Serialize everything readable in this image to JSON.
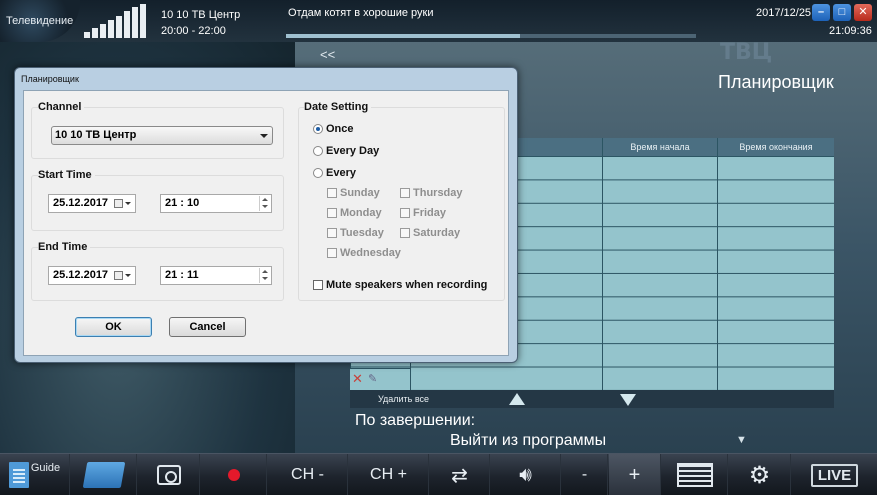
{
  "topbar": {
    "app_name": "Телевидение",
    "channel": "10 10 ТВ Центр",
    "time_range": "20:00 - 22:00",
    "program": "Отдам котят в хорошие руки",
    "progress_fraction": 0.57,
    "date": "2017/12/25",
    "clock": "21:09:36",
    "signal_bars": [
      0.18,
      0.3,
      0.42,
      0.54,
      0.66,
      0.78,
      0.9,
      1.0
    ],
    "window_buttons": [
      "minimize-icon",
      "maximize-icon",
      "close-icon"
    ]
  },
  "scheduler": {
    "back_label": "<<",
    "title": "Планировщик",
    "columns": [
      "Время начала",
      "Время окончания"
    ],
    "delete_all": "Удалить все",
    "on_finish_label": "По завершении:",
    "on_finish_value": "Выйти из программы"
  },
  "dialog": {
    "title": "Планировщик",
    "channel_group": "Channel",
    "channel_value": "10 10 ТВ Центр",
    "start_group": "Start Time",
    "start_date": "25.12.2017",
    "start_time": "21 : 10",
    "end_group": "End Time",
    "end_date": "25.12.2017",
    "end_time": "21 : 11",
    "date_group": "Date Setting",
    "radio_once": "Once",
    "radio_every_day": "Every Day",
    "radio_every": "Every",
    "days": {
      "sunday": "Sunday",
      "monday": "Monday",
      "tuesday": "Tuesday",
      "wednesday": "Wednesday",
      "thursday": "Thursday",
      "friday": "Friday",
      "saturday": "Saturday"
    },
    "mute_label": "Mute speakers when recording",
    "ok_label": "OK",
    "cancel_label": "Cancel"
  },
  "toolbar": {
    "guide": "Guide",
    "ch_minus": "CH -",
    "ch_plus": "CH +",
    "vol_minus": "-",
    "vol_plus": "+",
    "live": "LIVE"
  },
  "logo_text": "ТВЦ"
}
